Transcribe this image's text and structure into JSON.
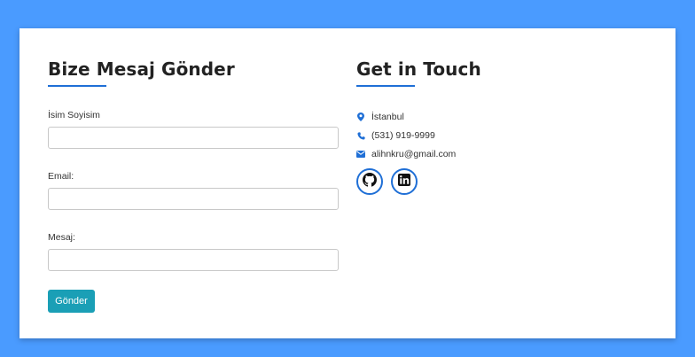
{
  "form": {
    "title": "Bize Mesaj Gönder",
    "fields": [
      {
        "label": "İsim Soyisim",
        "value": "",
        "placeholder": ""
      },
      {
        "label": "Email:",
        "value": "",
        "placeholder": ""
      },
      {
        "label": "Mesaj:",
        "value": "",
        "placeholder": ""
      }
    ],
    "submit_label": "Gönder"
  },
  "contact": {
    "title": "Get in Touch",
    "location": "İstanbul",
    "phone": "(531) 919-9999",
    "email": "alihnkru@gmail.com"
  },
  "socials": [
    {
      "icon": "github-icon"
    },
    {
      "icon": "linkedin-icon"
    }
  ],
  "colors": {
    "background": "#4a9bff",
    "accent": "#1f6fd6",
    "button": "#1a9fb6"
  }
}
